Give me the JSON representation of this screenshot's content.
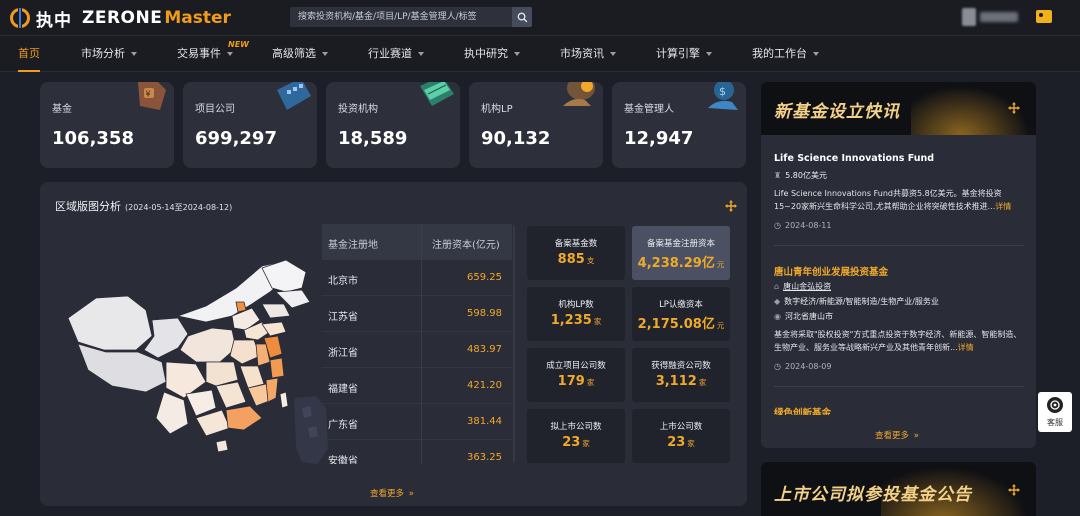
{
  "brand": {
    "name_cn": "执中",
    "name_en": "ZERONE",
    "name_suffix": "Master"
  },
  "search": {
    "placeholder": "搜索投资机构/基金/项目/LP/基金管理人/标签"
  },
  "nav": {
    "items": [
      {
        "label": "首页",
        "active": true
      },
      {
        "label": "市场分析",
        "caret": true
      },
      {
        "label": "交易事件",
        "caret": true,
        "badge": "NEW"
      },
      {
        "label": "高级筛选",
        "caret": true
      },
      {
        "label": "行业赛道",
        "caret": true
      },
      {
        "label": "执中研究",
        "caret": true
      },
      {
        "label": "市场资讯",
        "caret": true
      },
      {
        "label": "计算引擎",
        "caret": true
      },
      {
        "label": "我的工作台",
        "caret": true
      }
    ]
  },
  "stats": [
    {
      "label": "基金",
      "value": "106,358",
      "icon": "money-bag-icon"
    },
    {
      "label": "项目公司",
      "value": "699,297",
      "icon": "company-card-icon"
    },
    {
      "label": "投资机构",
      "value": "18,589",
      "icon": "money-stack-icon"
    },
    {
      "label": "机构LP",
      "value": "90,132",
      "icon": "investor-hand-icon"
    },
    {
      "label": "基金管理人",
      "value": "12,947",
      "icon": "manager-coin-icon"
    }
  ],
  "region": {
    "title": "区域版图分析",
    "range": "(2024-05-14至2024-08-12)",
    "table": {
      "headers": [
        "基金注册地",
        "注册资本(亿元)"
      ],
      "rows": [
        {
          "name": "北京市",
          "value": "659.25"
        },
        {
          "name": "江苏省",
          "value": "598.98"
        },
        {
          "name": "浙江省",
          "value": "483.97"
        },
        {
          "name": "福建省",
          "value": "421.20"
        },
        {
          "name": "广东省",
          "value": "381.44"
        },
        {
          "name": "安徽省",
          "value": "363.25"
        }
      ]
    },
    "metrics": [
      {
        "label": "备案基金数",
        "value": "885",
        "unit": "支"
      },
      {
        "label": "备案基金注册资本",
        "value": "4,238.29亿",
        "unit": "元",
        "highlight": true
      },
      {
        "label": "机构LP数",
        "value": "1,235",
        "unit": "家"
      },
      {
        "label": "LP认缴资本",
        "value": "2,175.08亿",
        "unit": "元"
      },
      {
        "label": "成立项目公司数",
        "value": "179",
        "unit": "家"
      },
      {
        "label": "获得融资公司数",
        "value": "3,112",
        "unit": "家"
      },
      {
        "label": "拟上市公司数",
        "value": "23",
        "unit": "家"
      },
      {
        "label": "上市公司数",
        "value": "23",
        "unit": "家"
      }
    ],
    "more": "查看更多"
  },
  "news": {
    "banner": "新基金设立快讯",
    "items": [
      {
        "title": "Life Science Innovations Fund",
        "title_color": "#ffffff",
        "amount": "5.80亿美元",
        "desc": "Life Science Innovations Fund共募资5.8亿美元。基金将投资15~20家新兴生命科学公司,尤其帮助企业将突破性技术推进...",
        "detail": "详情",
        "date": "2024-08-11"
      },
      {
        "title": "唐山青年创业发展投资基金",
        "title_color": "#f0a92a",
        "manager": "唐山金弘投资",
        "tags": "数字经济/新能源/智能制造/生物产业/服务业",
        "location": "河北省唐山市",
        "desc": "基金将采取\"股权投资\"方式重点投资于数字经济、新能源、智能制造、生物产业、服务业等战略新兴产业及其他青年创新...",
        "detail": "详情",
        "date": "2024-08-09"
      },
      {
        "title": "绿色创新基金",
        "title_color": "#f0a92a"
      }
    ],
    "more": "查看更多"
  },
  "announcement": {
    "banner": "上市公司拟参投基金公告"
  },
  "service": {
    "label": "客服"
  },
  "colors": {
    "accent": "#f09b1a",
    "value": "#f0a92a",
    "panel": "#2a2d38",
    "card": "#2d303b",
    "bg": "#1c1f27"
  }
}
